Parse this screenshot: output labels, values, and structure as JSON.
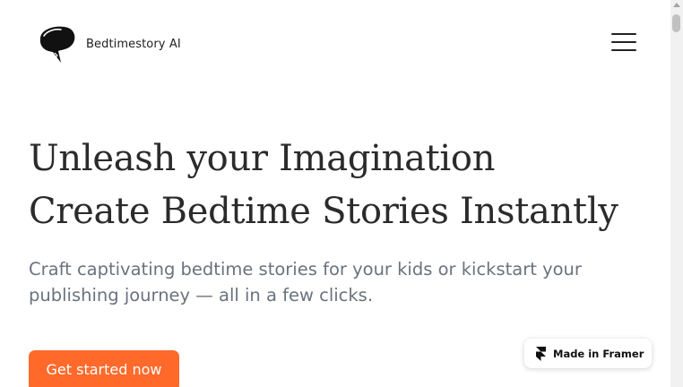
{
  "header": {
    "brand_name": "Bedtimestory AI",
    "logo_icon": "speech-bubble-lightning-icon",
    "menu_icon": "hamburger-menu-icon"
  },
  "hero": {
    "title_line_1": "Unleash your Imagination",
    "title_line_2": "Create Bedtime Stories Instantly",
    "subtitle": "Craft captivating bedtime stories for your kids or kickstart your publishing journey — all in a few clicks.",
    "cta_label": "Get started now"
  },
  "framer_badge": {
    "label": "Made in Framer",
    "icon": "framer-logo-icon"
  },
  "colors": {
    "accent": "#ff6a2b",
    "title_text": "#2b2b2b",
    "subtitle_text": "#6a737d"
  }
}
